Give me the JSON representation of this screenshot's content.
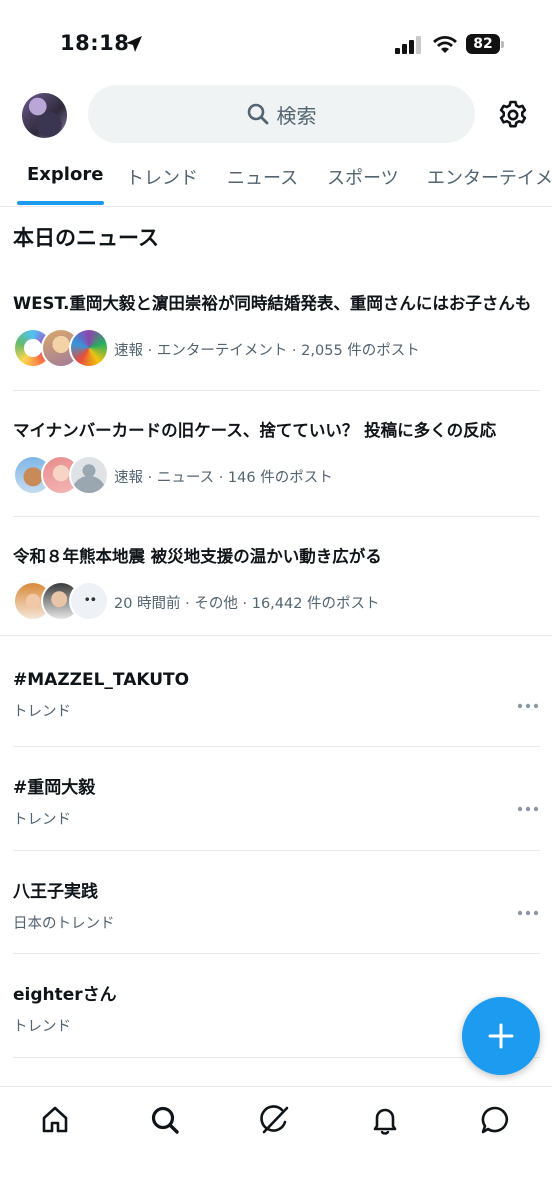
{
  "status_bar": {
    "time": "18:18",
    "battery": "82"
  },
  "header": {
    "search_placeholder": "検索"
  },
  "tabs": [
    {
      "label": "Explore",
      "active": true
    },
    {
      "label": "トレンド"
    },
    {
      "label": "ニュース"
    },
    {
      "label": "スポーツ"
    },
    {
      "label": "エンターテイメント"
    }
  ],
  "news_section": {
    "title": "本日のニュース",
    "items": [
      {
        "title": "WEST.重岡大毅と濵田崇裕が同時結婚発表、重岡さんにはお子さんも",
        "meta": "速報 · エンターテイメント · 2,055 件のポスト"
      },
      {
        "title": "マイナンバーカードの旧ケース、捨てていい？ 投稿に多くの反応",
        "meta": "速報 · ニュース · 146 件のポスト"
      },
      {
        "title": "令和８年熊本地震 被災地支援の温かい動き広がる",
        "meta": "20 時間前 · その他 · 16,442 件のポスト"
      }
    ]
  },
  "trends": [
    {
      "name": "#MAZZEL_TAKUTO",
      "context": "トレンド"
    },
    {
      "name": "#重岡大毅",
      "context": "トレンド"
    },
    {
      "name": "八王子実践",
      "context": "日本のトレンド"
    },
    {
      "name": "eighterさん",
      "context": "トレンド"
    }
  ],
  "icons": {
    "avatar": "profile-avatar",
    "settings": "gear-icon",
    "fab": "plus-icon",
    "nav": [
      "home-icon",
      "search-icon",
      "grok-icon",
      "bell-icon",
      "message-icon"
    ]
  },
  "colors": {
    "accent": "#1d9bf0",
    "text": "#0f1419",
    "secondary": "#536471"
  }
}
